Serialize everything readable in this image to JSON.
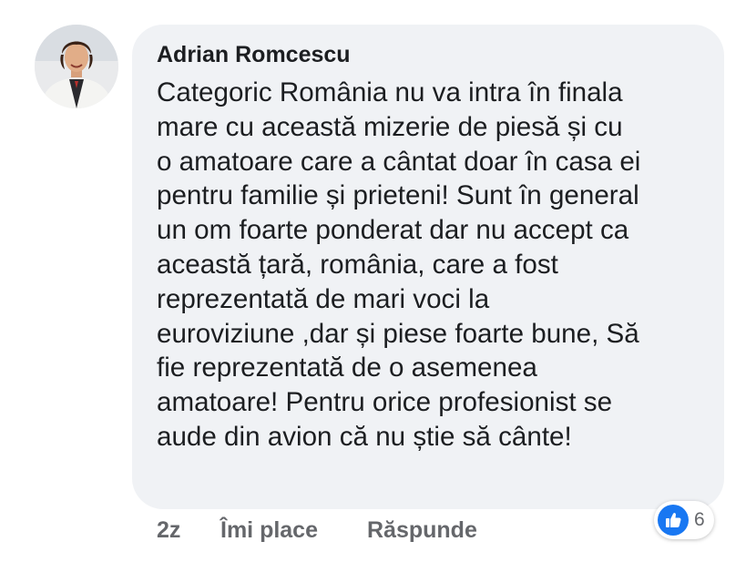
{
  "comment": {
    "author": "Adrian Romcescu",
    "text_lines": [
      "Categoric România nu va intra în finala",
      "mare cu această mizerie de piesă și cu",
      "o amatoare care a cântat doar în casa ei",
      "pentru familie și prieteni! Sunt în general",
      "un om foarte ponderat dar nu accept ca",
      "această țară, românia, care a fost",
      "reprezentată de mari voci la",
      "euroviziune ,dar și piese foarte bune, Să",
      "fie reprezentată de o asemenea",
      "amatoare! Pentru orice profesionist se",
      "aude din avion că nu știe să cânte!"
    ]
  },
  "actions": {
    "time": "2z",
    "like_label": "Îmi place",
    "reply_label": "Răspunde"
  },
  "reactions": {
    "icon": "thumbs-up-icon",
    "count": "6"
  },
  "colors": {
    "bubble": "#f0f2f5",
    "text": "#1c1e21",
    "secondary": "#65676b",
    "like_blue": "#1877f2"
  }
}
